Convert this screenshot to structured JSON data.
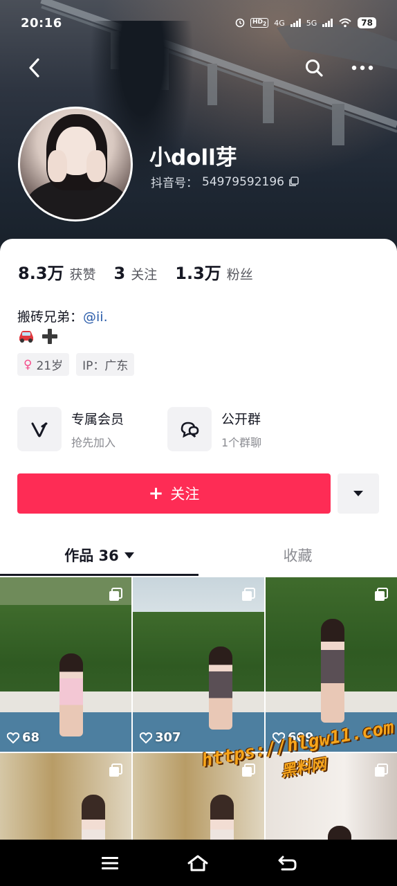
{
  "status_bar": {
    "time": "20:16",
    "hd": "HD",
    "hd_sub": "2",
    "net1": "4G",
    "net2": "5G",
    "battery": "78"
  },
  "header": {
    "back_icon": "chevron-left-icon",
    "search_icon": "search-icon",
    "more_icon": "more-dots-icon"
  },
  "profile": {
    "name": "小doll芽",
    "id_label": "抖音号：",
    "id_value": "54979592196"
  },
  "stats": [
    {
      "value": "8.3万",
      "label": "获赞"
    },
    {
      "value": "3",
      "label": "关注"
    },
    {
      "value": "1.3万",
      "label": "粉丝"
    }
  ],
  "bio": {
    "text": "搬砖兄弟：",
    "mention": "@ii.",
    "emojis": [
      "🚗",
      "➕"
    ]
  },
  "tags": [
    {
      "icon": "female-icon",
      "symbol": "♀",
      "text": "21岁"
    },
    {
      "text": "IP：广东"
    }
  ],
  "features": [
    {
      "title": "专属会员",
      "subtitle": "抢先加入",
      "icon": "vip-v-icon"
    },
    {
      "title": "公开群",
      "subtitle": "1个群聊",
      "icon": "group-chat-icon"
    }
  ],
  "actions": {
    "follow_plus": "+",
    "follow_label": "关注",
    "dropdown_icon": "triangle-down-icon"
  },
  "tabs": [
    {
      "label": "作品 36",
      "active": true
    },
    {
      "label": "收藏",
      "active": false
    }
  ],
  "videos": [
    {
      "likes": "68"
    },
    {
      "likes": "307"
    },
    {
      "likes": "609"
    },
    {
      "likes": ""
    },
    {
      "likes": ""
    },
    {
      "likes": ""
    }
  ],
  "watermark": {
    "url": "https://hlgw11.com",
    "name": "黑料网"
  },
  "colors": {
    "accent": "#fe2c55",
    "mention": "#2a5caa",
    "text": "#161823",
    "muted": "#8a8b91"
  }
}
